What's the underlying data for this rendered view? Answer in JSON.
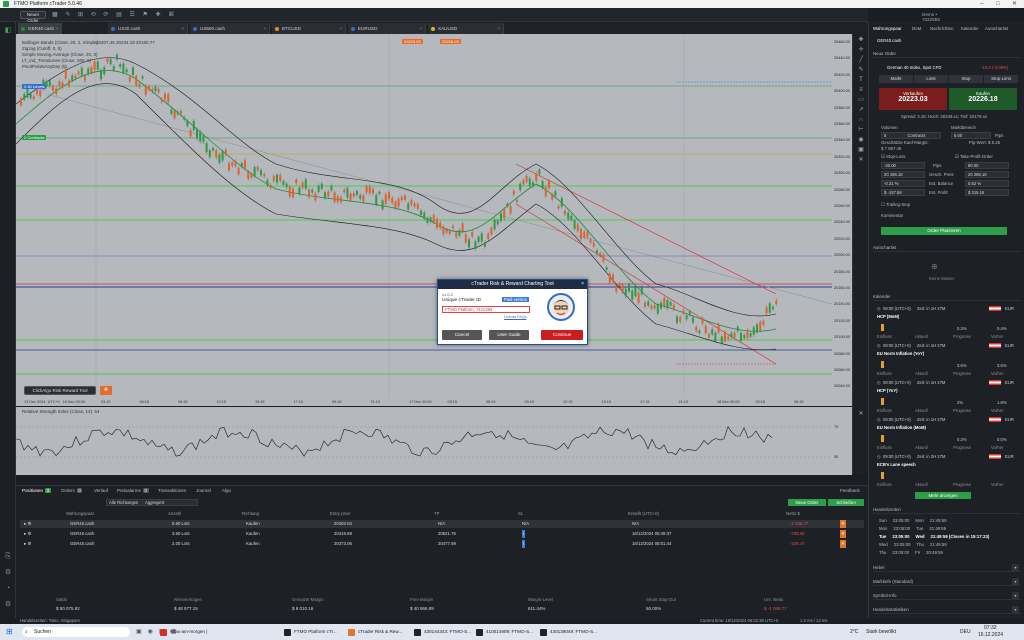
{
  "window": {
    "title": "FTMO Platform cTrader 5.0.46",
    "account_info": "Demo • 7322556 • Hedging • $ 50 075.92 • 1:30",
    "minimize": "–",
    "maximize": "□",
    "close": "✕"
  },
  "menubar": {
    "new_order": "Neuer Order"
  },
  "chart_tabs": [
    {
      "label": "GER40.cash",
      "color": "#2a8a3d"
    },
    {
      "label": "US30.cash",
      "color": "#3b6bc4"
    },
    {
      "label": "US500.cash",
      "color": "#3b6bc4"
    },
    {
      "label": "BTCUSD",
      "color": "#e39222"
    },
    {
      "label": "EURUSD",
      "color": "#3b6bc4"
    },
    {
      "label": "XAUUSD",
      "color": "#d8b72a"
    }
  ],
  "chart": {
    "indicators": [
      "Bollinger Bands (Close, 20, 2, Simple)",
      "Zigzag (Cutoff, 0, 5)",
      "Simple Moving Average (Close, 20, 0)",
      "LT_ind_TrendLines (Close, 200, 0)",
      "PivotPointsAnyDay (5)"
    ],
    "ohlc_bar": "20207.45 20234.19 20180.77",
    "top_prices": [
      "20223.03",
      "20226.03"
    ],
    "label_left1": "2.40 Levels",
    "label_left2": "2 Contracts",
    "price_scale": [
      "20460.00",
      "20440.00",
      "20420.00",
      "20400.00",
      "20380.00",
      "20360.00",
      "20340.00",
      "20320.00",
      "20300.00",
      "20280.00",
      "20260.00",
      "20240.00",
      "20220.00",
      "20200.00",
      "20180.00",
      "20160.00",
      "20140.00",
      "20120.00",
      "20100.00",
      "20080.00",
      "20060.00",
      "20040.00"
    ],
    "time_labels": [
      "13 Dec 2024, UTC+0",
      "16 Dec 00:00",
      "03:15",
      "06:15",
      "09:15",
      "12:15",
      "15:15",
      "17:15",
      "09:15",
      "21:15",
      "17 Dec 00:00",
      "03:15",
      "06:15",
      "09:15",
      "12:15",
      "15:15",
      "17:15",
      "21:15",
      "18 Dec 00:00",
      "03:15",
      "06:15"
    ],
    "tool_label": "ClickAlgo Risk Reward Tool",
    "rsi_label": "Relative Strength Index (Close, 14): 54",
    "rsi_scale": [
      "70",
      "30"
    ]
  },
  "dialog": {
    "title": "cTrader Risk & Reward Charting Tool",
    "version": "v1.0.2",
    "uid_label": "Unique cTrader ID",
    "paid": "Paid version",
    "uid_value": "FTMO Platform, 7421393",
    "license": "License FAQs",
    "cancel": "Cancel",
    "guide": "User Guide",
    "continue": "Continue"
  },
  "bottom": {
    "tabs": [
      {
        "label": "Positionen",
        "count": "3"
      },
      {
        "label": "Orders",
        "count": "0"
      },
      {
        "label": "Verlauf"
      },
      {
        "label": "Preisalarme",
        "count": "0"
      },
      {
        "label": "Transaktionen"
      },
      {
        "label": "Journal"
      },
      {
        "label": "Algo"
      }
    ],
    "feedback": "Feedback",
    "filter1": "Alle Richtungen",
    "filter2": "Aggregiert",
    "new_order": "Neue Order",
    "close_btn": "Schließen",
    "columns": [
      "Wahrungspaar",
      "Anzahl",
      "Richtung",
      "Entry price",
      "TP",
      "SL",
      "Erstellt (UTC+0)",
      "Netto $"
    ],
    "rows": [
      {
        "pair": "GER40.cash",
        "qty": "5.60 Lots",
        "dir": "Kaufen",
        "entry": "20403.04",
        "tp": "N/A",
        "sl": "N/A",
        "created": "N/A",
        "net": "-1 036.77"
      },
      {
        "pair": "GER40.cash",
        "qty": "3.60 Lots",
        "dir": "Kaufen",
        "entry": "20419.69",
        "tp": "20521.76",
        "sl": "i",
        "created": "16/12/2024 05:49:37",
        "net": "-708.30"
      },
      {
        "pair": "GER40.cash",
        "qty": "2.00 Lots",
        "dir": "Kaufen",
        "entry": "20373.06",
        "tp": "20477.99",
        "sl": "i",
        "created": "16/12/2024 08:01:44",
        "net": "-328.47"
      }
    ],
    "summary": [
      {
        "label": "Saldo",
        "value": "$ 50 075.92"
      },
      {
        "label": "Reinvermögen",
        "value": "$ 48 977.15"
      },
      {
        "label": "Genutzte Margin",
        "value": "$ 8 010.16"
      },
      {
        "label": "Free Margin",
        "value": "$ 40 966.99"
      },
      {
        "label": "Margin-Level",
        "value": "611.44%"
      },
      {
        "label": "Smart Stop-Out",
        "value": "50.00%"
      },
      {
        "label": "Unr. Netto",
        "value": "$ -1 098.77"
      }
    ]
  },
  "status": {
    "left": "Handelszeiten: Tokio, Singapore",
    "right_time": "Current time: 16/12/2024 06:32:36 UTC+0",
    "right_ping": "1.2 ms / 13 ms"
  },
  "right_panel": {
    "tabs": [
      "Wahrungspaar",
      "DoM",
      "Nachrichten",
      "Kalender",
      "Autochartist"
    ],
    "symbol": "GER40.cash",
    "section_new_order": "Neue Order",
    "instrument": "German 40 Index, Spot CFD",
    "change": "-15.2 (-0.08%)",
    "order_types": [
      "Markt",
      "Limit",
      "Stop",
      "Stop-Limit"
    ],
    "sell_label": "Verkaufen",
    "sell_price": "20223.03",
    "buy_label": "Kaufen",
    "buy_price": "20226.18",
    "spread": "Spread: 3.15; Hoch: 20249.xx; Tief: 20179.xx",
    "volume_label": "Volumen",
    "volume_value": "5",
    "volume_unit": "Contracts",
    "market_range": "Marktbereich",
    "pips_value": "5.00",
    "pips_label": "Pips",
    "margin": "Geschätzte Kauf-Margin:",
    "margin_val": "$ 7 087.45",
    "pip_value": "Pip-Wert: $ 5.25",
    "stoploss": "Stop-Loss",
    "takeprofit": "Take-Profit-Order",
    "sl_pips": "-30.00",
    "tp_pips": "60.00",
    "sl_price": "20 196.18",
    "tp_price": "20 286.18",
    "sl_pct": "-0.31 %",
    "tp_pct": "0.62 %",
    "sl_usd": "$ -157.58",
    "tp_usd": "$ 315.16",
    "pips_lbl": "Pips",
    "price_lbl": "Gesch. Preis",
    "bal_lbl": "Est. Balance",
    "prof_lbl": "Est. Profit",
    "trailing": "Trailing-Stop",
    "comment": "Kommentar",
    "place_order": "Order Platzieren",
    "autochartist": "Autochartist",
    "no_patterns": "Keine Muster",
    "calendar": "Kalender",
    "events": [
      {
        "time": "08:00 (UTC+0)",
        "eta": "Zeit: in 1H 27M",
        "name": "HCP (MoM)",
        "ccy": "EUR",
        "v1": "0.3%",
        "v2": "0.4%"
      },
      {
        "time": "08:00 (UTC+0)",
        "eta": "Zeit: in 1H 27M",
        "name": "EU Norm Inflation (YoY)",
        "ccy": "EUR",
        "v1": "3.6%",
        "v2": "3.5%"
      },
      {
        "time": "08:00 (UTC+0)",
        "eta": "Zeit: in 1H 27M",
        "name": "HCP (YoY)",
        "ccy": "EUR",
        "v1": "2%",
        "v2": "1.8%"
      },
      {
        "time": "08:00 (UTC+0)",
        "eta": "Zeit: in 1H 27M",
        "name": "EU Norm Inflation (MoM)",
        "ccy": "EUR",
        "v1": "0.2%",
        "v2": "0.0%"
      },
      {
        "time": "09:00 (UTC+0)",
        "eta": "Zeit: in 2H 27M",
        "name": "ECB's Lane speech",
        "ccy": "EUR",
        "v1": "",
        "v2": ""
      }
    ],
    "ev_cols": [
      "Einfluss",
      "Aktuell",
      "Prognose",
      "Vorher"
    ],
    "more": "Mehr anzeigen",
    "sessions": "Handelszeiten",
    "sessions_rows": [
      {
        "d": "Sun",
        "a": "23:05:00",
        "b": "Mon",
        "c": "21:49:59"
      },
      {
        "d": "Mon",
        "a": "23:05:00",
        "b": "Tue",
        "c": "21:49:59"
      },
      {
        "d": "Tue",
        "a": "23:05:00",
        "b": "Wed",
        "c": "21:49:59 (Closes in 15:17:23)"
      },
      {
        "d": "Wed",
        "a": "23:05:00",
        "b": "Thu",
        "c": "21:49:59"
      },
      {
        "d": "Thu",
        "a": "23:05:00",
        "b": "Fri",
        "c": "20:49:59"
      }
    ],
    "hebel": "Hebel",
    "marktiefe": "Marktiefe (Standard)",
    "symbolinfo": "Symbol-Info",
    "handelsstatistik": "Handelsstatistiken"
  },
  "taskbar": {
    "search": "Suchen",
    "items": [
      "#dax-am-morgen |",
      "FTMO Platform cTr...",
      "cTrader Risk & Rew...",
      "430144343: FTMO-S...",
      "410014909: FTMO-S...",
      "430139049: FTMO-S..."
    ],
    "temp": "2°C",
    "weather": "Stark bewölkt",
    "lang": "DEU",
    "clock": "07:32",
    "date": "16.12.2024"
  }
}
